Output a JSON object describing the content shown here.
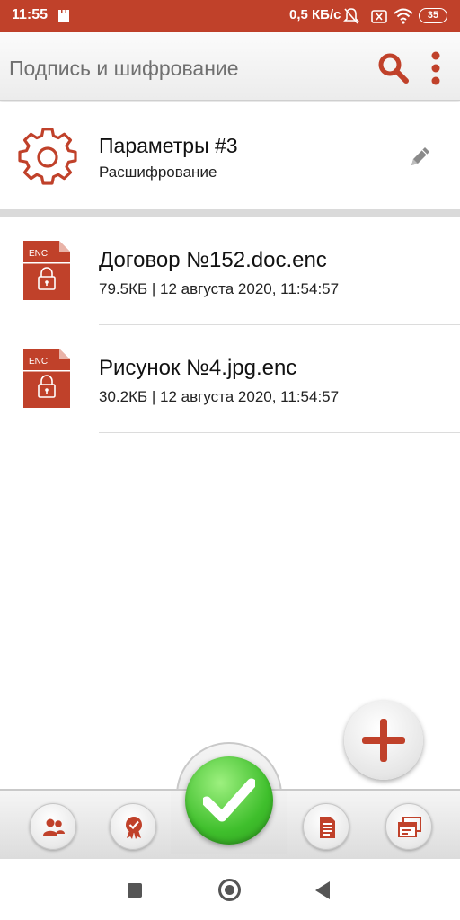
{
  "status_bar": {
    "time": "11:55",
    "network_speed": "0,5 КБ/с",
    "battery_level": "35",
    "icons": [
      "notification-icon",
      "bell-muted-icon",
      "sim-off-icon",
      "wifi-icon",
      "battery-icon"
    ]
  },
  "app_bar": {
    "title": "Подпись и шифрование",
    "icons": [
      "search-icon",
      "more-vert-icon"
    ]
  },
  "parameters": {
    "title": "Параметры #3",
    "subtitle": "Расшифрование",
    "icons": [
      "gear-icon",
      "pencil-icon"
    ]
  },
  "files": [
    {
      "badge": "ENC",
      "name": "Договор №152.doc.enc",
      "meta": "79.5КБ | 12 августа 2020, 11:54:57"
    },
    {
      "badge": "ENC",
      "name": "Рисунок №4.jpg.enc",
      "meta": "30.2КБ | 12 августа 2020, 11:54:57"
    }
  ],
  "toolbar": {
    "buttons": [
      "contacts-icon",
      "certificate-icon",
      "checkmark-icon",
      "document-icon",
      "windows-icon"
    ]
  },
  "fab": {
    "icon": "plus-icon"
  },
  "colors": {
    "accent": "#c0412a",
    "confirm": "#3fbf2c"
  }
}
